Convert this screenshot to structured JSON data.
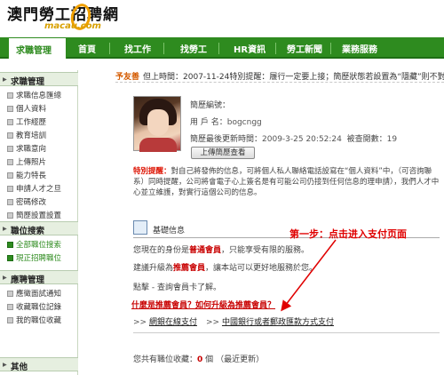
{
  "header": {
    "logo_cn": "澳門勞工招聘網",
    "logo_en": "macau.com"
  },
  "nav": {
    "active": "求職管理",
    "items": [
      "首頁",
      "找工作",
      "找勞工",
      "HR資訊",
      "勞工新聞",
      "業務服務"
    ]
  },
  "notice": {
    "label": "予友善",
    "text": "但上時間：2007-11-24特別提醒：履行一定要上接；簡歷狀態若設置為“隱藏”則不對"
  },
  "sidebar": {
    "sections": [
      {
        "title": "求職管理",
        "items": [
          "求職信息匯總",
          "個人資料",
          "工作經歷",
          "教育培訓",
          "求職意向",
          "上傳照片",
          "能力特長",
          "申請人才之旦",
          "密碼修改",
          "簡歷設置設置"
        ]
      },
      {
        "title": "職位搜索",
        "items": [
          "全部職位搜索",
          "現正招聘職位"
        ]
      },
      {
        "title": "應聘管理",
        "items": [
          "應徵面試通知",
          "收藏職位記錄",
          "我的職位收藏"
        ]
      },
      {
        "title": "其他",
        "items": []
      }
    ],
    "selected": "全部職位搜索"
  },
  "resume": {
    "no_label": "簡歷編號：",
    "no_value": "",
    "user_label": "用 戶 名：",
    "user_value": "bogcngg",
    "updated_label": "簡歷最後更新時間：",
    "updated_value": "2009-3-25 20:52:24",
    "views_label": "被查閱數：",
    "views_value": "19",
    "preview_button": "上傳簡歷查看"
  },
  "tip": {
    "label": "特別提醒：",
    "text": "對自己將發佈的信息，可將個人私人聯絡電話設寫在“個人資料”中，（可咨詢聯系）同時提醒，公司將會電子心上簽名是有可能公司仍接到任何信息的理申請），我們人才中心並立維護，對實行這個公司的信息。"
  },
  "info": {
    "title": "基礎信息",
    "line1_a": "您現在的身份是",
    "line1_hl": "普通會員",
    "line1_b": "，只能享受有限的服務。",
    "line2_a": "建議升級為",
    "line2_hl": "推薦會員",
    "line2_b": "，讓本站可以更好地服務於您。",
    "line3": "點擊 - 查詢會員卡了解。",
    "upgrade_link": "什麼是推薦會員？如何升級為推薦會員？",
    "pay1": "網銀在線支付",
    "pay2": "中國銀行或者郵政匯款方式支付"
  },
  "saved": {
    "a": "您共有",
    "b": "職位收藏：",
    "n": "0",
    "c": "個",
    "d": "（最近更新）"
  },
  "annotation": {
    "step": "第一步：点击进入支付页面"
  },
  "colors": {
    "nav_green": "#2e8b1f",
    "highlight_red": "#c80000",
    "annotation_red": "#e00000",
    "notice_orange": "#d45a00"
  }
}
